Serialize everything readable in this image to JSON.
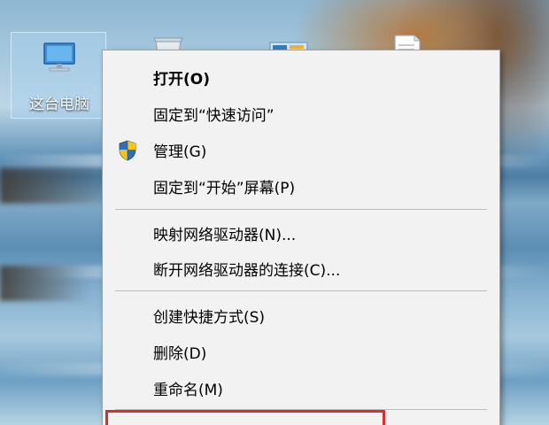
{
  "desktop": {
    "icons": [
      {
        "label": "这台电脑",
        "icon": "this-pc-icon",
        "selected": true
      },
      {
        "icon": "recycle-bin-icon"
      },
      {
        "icon": "control-panel-icon"
      },
      {
        "icon": "document-icon"
      }
    ]
  },
  "context_menu": {
    "items": [
      {
        "label": "打开(O)",
        "bold": true
      },
      {
        "label": "固定到“快速访问”"
      },
      {
        "label": "管理(G)",
        "icon": "uac-shield-icon"
      },
      {
        "label": "固定到“开始”屏幕(P)"
      },
      {
        "label": "映射网络驱动器(N)..."
      },
      {
        "label": "断开网络驱动器的连接(C)..."
      },
      {
        "label": "创建快捷方式(S)"
      },
      {
        "label": "删除(D)"
      },
      {
        "label": "重命名(M)"
      }
    ],
    "highlight_color": "#e12b2b"
  }
}
